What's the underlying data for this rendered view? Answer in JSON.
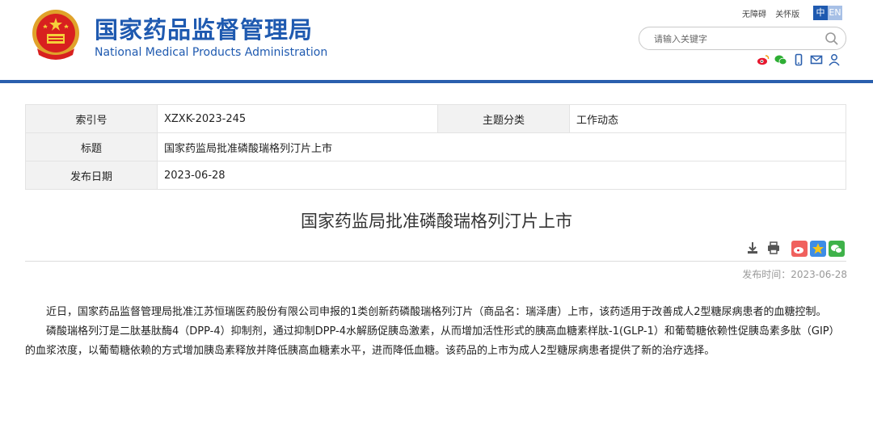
{
  "header": {
    "title_cn": "国家药品监督管理局",
    "title_en": "National Medical Products Administration",
    "links": [
      "无障碍",
      "关怀版"
    ],
    "lang": {
      "zh": "中",
      "en": "EN"
    },
    "search": {
      "placeholder": "请输入关键字",
      "value": ""
    },
    "social_icons": [
      "weibo-icon",
      "wechat-icon",
      "mobile-icon",
      "mail-icon",
      "user-icon"
    ],
    "brand_color": "#1f5ab0"
  },
  "info": {
    "index_label": "索引号",
    "index_value": "XZXK-2023-245",
    "category_label": "主题分类",
    "category_value": "工作动态",
    "title_label": "标题",
    "title_value": "国家药监局批准磷酸瑞格列汀片上市",
    "date_label": "发布日期",
    "date_value": "2023-06-28"
  },
  "article": {
    "title": "国家药监局批准磷酸瑞格列汀片上市",
    "publish_time": "发布时间：2023-06-28",
    "tool_icons": [
      "download-icon",
      "print-icon"
    ],
    "share_icons": [
      "weibo-share-icon",
      "qzone-share-icon",
      "wechat-share-icon"
    ],
    "paragraphs": [
      "近日，国家药品监督管理局批准江苏恒瑞医药股份有限公司申报的1类创新药磷酸瑞格列汀片（商品名：瑞泽唐）上市，该药适用于改善成人2型糖尿病患者的血糖控制。",
      "磷酸瑞格列汀是二肽基肽酶4（DPP-4）抑制剂，通过抑制DPP-4水解肠促胰岛激素，从而增加活性形式的胰高血糖素样肽-1(GLP-1）和葡萄糖依赖性促胰岛素多肽（GIP）的血浆浓度，以葡萄糖依赖的方式增加胰岛素释放并降低胰高血糖素水平，进而降低血糖。该药品的上市为成人2型糖尿病患者提供了新的治疗选择。"
    ]
  }
}
